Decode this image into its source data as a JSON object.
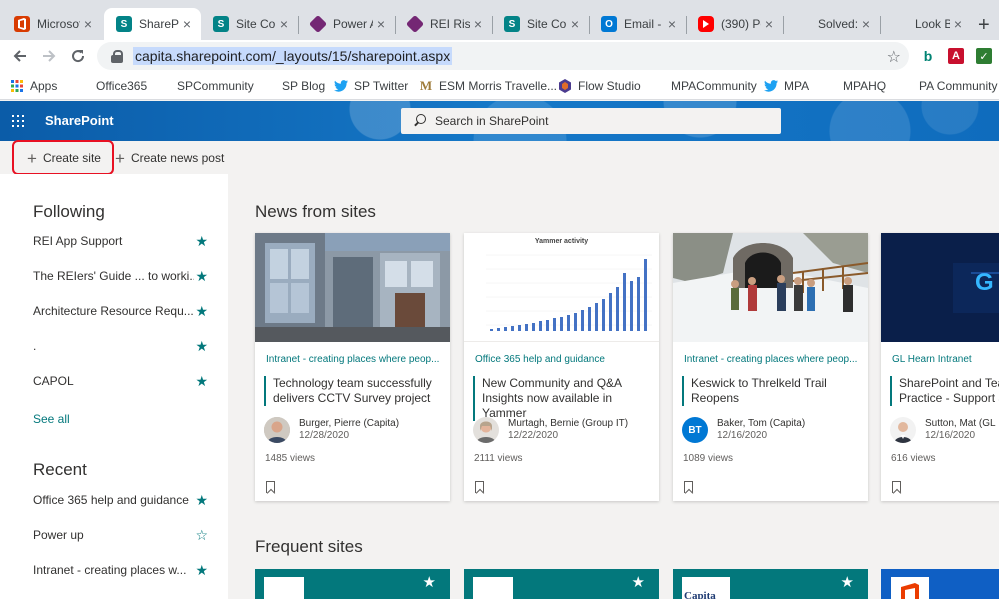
{
  "browser": {
    "tabs": [
      {
        "title": "Microsoft",
        "favicon": "office-icon",
        "color": "#d83b01"
      },
      {
        "title": "SharePoint",
        "favicon": "sharepoint-icon",
        "color": "#038387",
        "active": true
      },
      {
        "title": "Site Con",
        "favicon": "sharepoint-icon",
        "color": "#038387"
      },
      {
        "title": "Power A",
        "favicon": "powerapps-icon",
        "color": "#742774"
      },
      {
        "title": "REI Risk",
        "favicon": "powerapps-icon",
        "color": "#742774"
      },
      {
        "title": "Site Con",
        "favicon": "sharepoint-icon",
        "color": "#038387"
      },
      {
        "title": "Email - I",
        "favicon": "outlook-icon",
        "color": "#0078d4"
      },
      {
        "title": "(390) Po",
        "favicon": "youtube-icon",
        "color": "#ff0000"
      },
      {
        "title": "Solved:",
        "favicon": "microsoft-icon",
        "color": "#f25022"
      },
      {
        "title": "Look Bo",
        "favicon": "microsoft-icon",
        "color": "#f25022"
      }
    ],
    "url": "capita.sharepoint.com/_layouts/15/sharepoint.aspx",
    "bookmarks": [
      {
        "label": "Apps",
        "icon": "apps-grid-icon"
      },
      {
        "label": "Office365",
        "icon": "microsoft-icon"
      },
      {
        "label": "SPCommunity",
        "icon": "microsoft-icon"
      },
      {
        "label": "SP Blog",
        "icon": "microsoft-icon"
      },
      {
        "label": "SP Twitter",
        "icon": "twitter-icon"
      },
      {
        "label": "ESM Morris Travelle...",
        "icon": "m-logo-icon"
      },
      {
        "label": "Flow Studio",
        "icon": "flow-studio-icon"
      },
      {
        "label": "MPACommunity",
        "icon": "microsoft-icon"
      },
      {
        "label": "MPA",
        "icon": "twitter-icon"
      },
      {
        "label": "MPAHQ",
        "icon": "microsoft-icon"
      },
      {
        "label": "PA Community",
        "icon": "microsoft-icon"
      }
    ]
  },
  "suite": {
    "app_name": "SharePoint",
    "search_placeholder": "Search in SharePoint"
  },
  "commands": {
    "create_site": "Create site",
    "create_news": "Create news post"
  },
  "following": {
    "heading": "Following",
    "items": [
      {
        "label": "REI App Support"
      },
      {
        "label": "The REIers' Guide ... to worki..."
      },
      {
        "label": "Architecture Resource Requ..."
      },
      {
        "label": "."
      },
      {
        "label": "CAPOL"
      }
    ],
    "see_all": "See all"
  },
  "recent": {
    "heading": "Recent",
    "items": [
      {
        "label": "Office 365 help and guidance",
        "followed": true
      },
      {
        "label": "Power up",
        "followed": false
      },
      {
        "label": "Intranet - creating places w...",
        "followed": true
      }
    ]
  },
  "news": {
    "heading": "News from sites",
    "cards": [
      {
        "site": "Intranet - creating places where peop...",
        "headline": "Technology team successfully delivers CCTV Survey project",
        "author": "Burger, Pierre (Capita)",
        "date": "12/28/2020",
        "views": "1485 views",
        "avatar": "photo"
      },
      {
        "site": "Office 365 help and guidance",
        "headline": "New Community and Q&A Insights now available in Yammer",
        "author": "Murtagh, Bernie (Group IT)",
        "date": "12/22/2020",
        "views": "2111 views",
        "avatar": "photo",
        "chart_title": "Yammer activity"
      },
      {
        "site": "Intranet - creating places where peop...",
        "headline": "Keswick to Threlkeld Trail Reopens",
        "author": "Baker, Tom (Capita)",
        "date": "12/16/2020",
        "views": "1089 views",
        "avatar": "BT"
      },
      {
        "site": "GL Hearn Intranet",
        "headline": "SharePoint and Teams Best Practice - Support an",
        "author": "Sutton, Mat (GL",
        "date": "12/16/2020",
        "views": "616 views",
        "avatar": "photo",
        "thumb_text": "G"
      }
    ]
  },
  "frequent": {
    "heading": "Frequent sites",
    "logo_text": "Capita"
  }
}
